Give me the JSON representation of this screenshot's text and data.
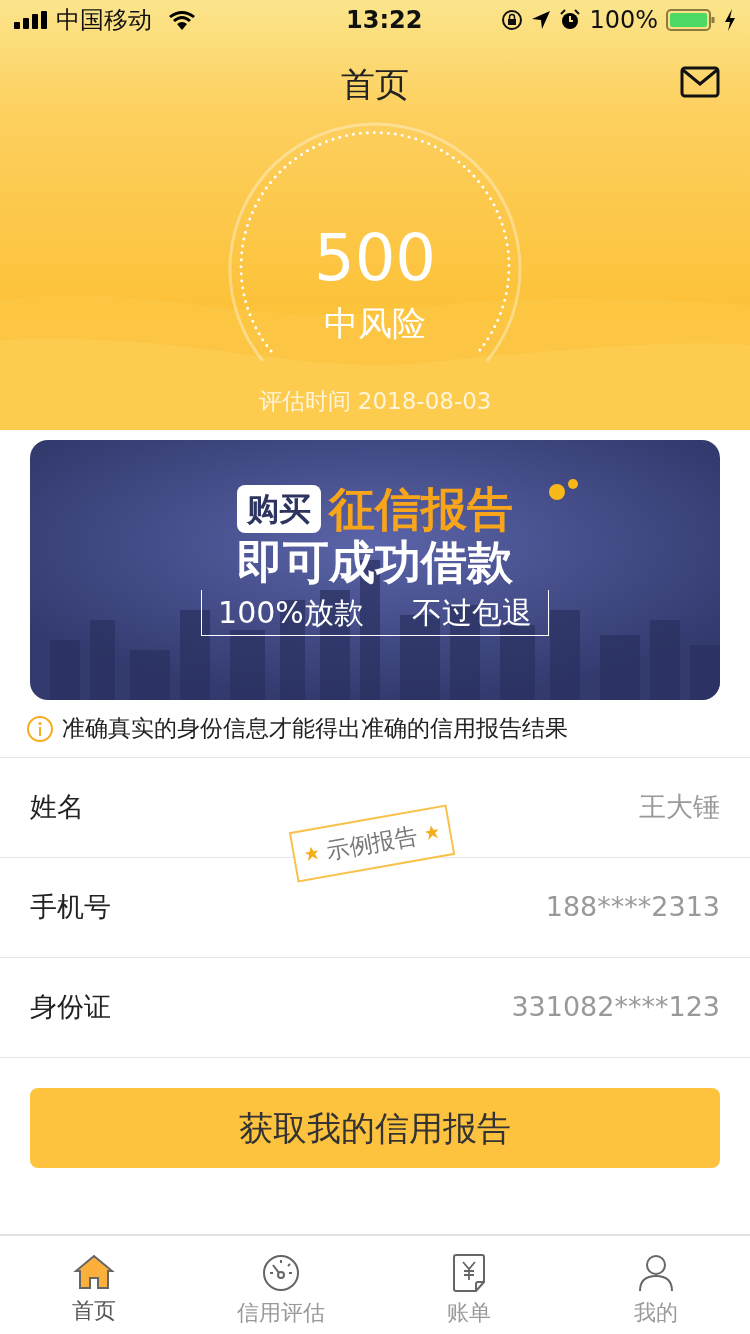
{
  "status_bar": {
    "carrier": "中国移动",
    "time": "13:22",
    "battery": "100%"
  },
  "header": {
    "title": "首页"
  },
  "score": {
    "value": "500",
    "risk": "中风险",
    "date": "评估时间 2018-08-03"
  },
  "banner": {
    "tag": "购买",
    "headline": "征信报告",
    "subline": "即可成功借款",
    "slogan_1": "100%放款",
    "slogan_2": "不过包退"
  },
  "notice": "准确真实的身份信息才能得出准确的信用报告结果",
  "stamp": "示例报告",
  "fields": [
    {
      "label": "姓名",
      "value": "王大锤"
    },
    {
      "label": "手机号",
      "value": "188****2313"
    },
    {
      "label": "身份证",
      "value": "331082****123"
    }
  ],
  "action": "获取我的信用报告",
  "tabs": [
    {
      "label": "首页",
      "kind": "home",
      "selected": true
    },
    {
      "label": "信用评估",
      "kind": "gauge",
      "selected": false
    },
    {
      "label": "账单",
      "kind": "bill",
      "selected": false
    },
    {
      "label": "我的",
      "kind": "person",
      "selected": false
    }
  ]
}
